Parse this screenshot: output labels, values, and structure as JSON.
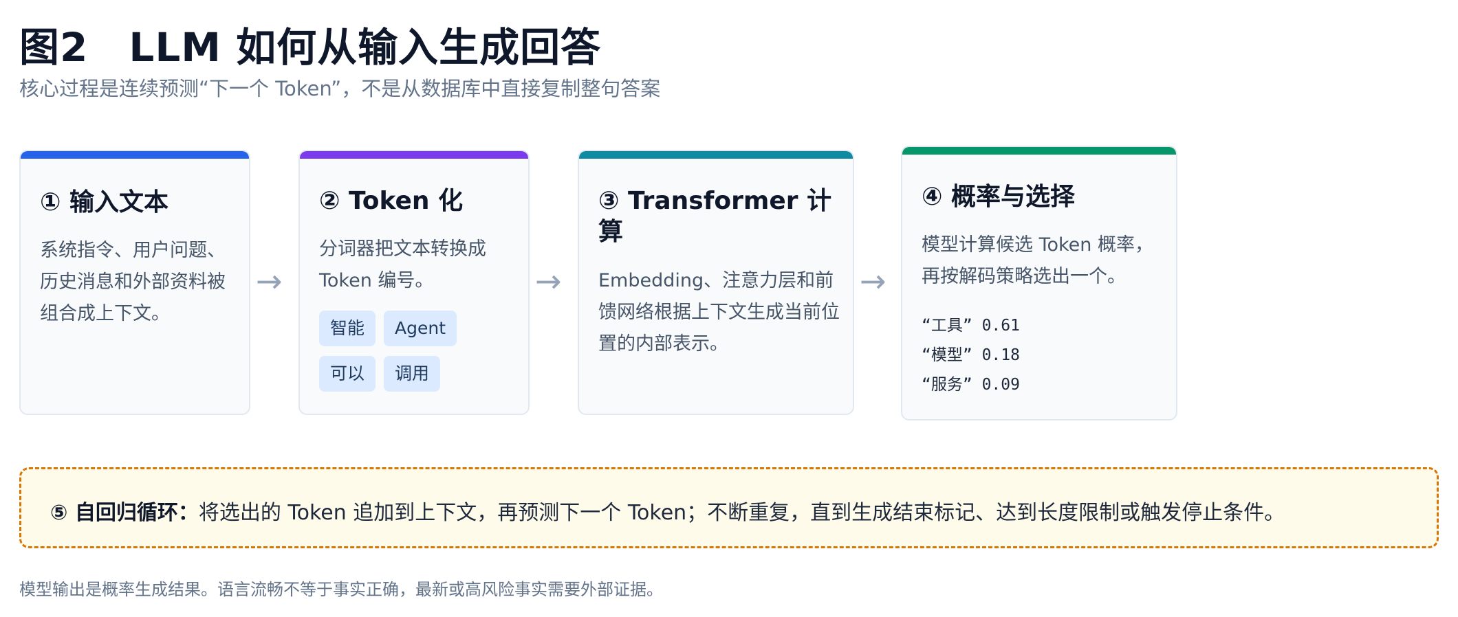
{
  "header": {
    "title": "图2　LLM 如何从输入生成回答",
    "subtitle": "核心过程是连续预测“下一个 Token”，不是从数据库中直接复制整句答案"
  },
  "colors": {
    "step1": "#2563eb",
    "step2": "#7c3aed",
    "step3": "#0e8aa3",
    "step4": "#059669",
    "loop_border": "#d97706",
    "arrow": "#94a3b8"
  },
  "steps": [
    {
      "title": "① 输入文本",
      "desc_lines": [
        "系统指令、用户问题、",
        "历史消息和外部资料被",
        "组合成上下文。"
      ]
    },
    {
      "title": "② Token 化",
      "desc_lines": [
        "分词器把文本转换成",
        "Token 编号。"
      ],
      "chips": [
        "智能",
        "Agent",
        "可以",
        "调用"
      ]
    },
    {
      "title_lines": [
        "③ Transformer 计",
        "算"
      ],
      "desc_lines": [
        "Embedding、注意力层和前",
        "馈网络根据上下文生成当前位",
        "置的内部表示。"
      ]
    },
    {
      "title": "④ 概率与选择",
      "desc_lines": [
        "模型计算候选 Token 概率，",
        "再按解码策略选出一个。"
      ],
      "candidates": [
        {
          "token": "“工具”",
          "prob": "0.61"
        },
        {
          "token": "“模型”",
          "prob": "0.18"
        },
        {
          "token": "“服务”",
          "prob": "0.09"
        }
      ]
    }
  ],
  "arrows": [
    "→",
    "→",
    "→"
  ],
  "loop": {
    "label": "⑤ 自回归循环：",
    "text": "将选出的 Token 追加到上下文，再预测下一个 Token；不断重复，直到生成结束标记、达到长度限制或触发停止条件。"
  },
  "footnote": "模型输出是概率生成结果。语言流畅不等于事实正确，最新或高风险事实需要外部证据。"
}
